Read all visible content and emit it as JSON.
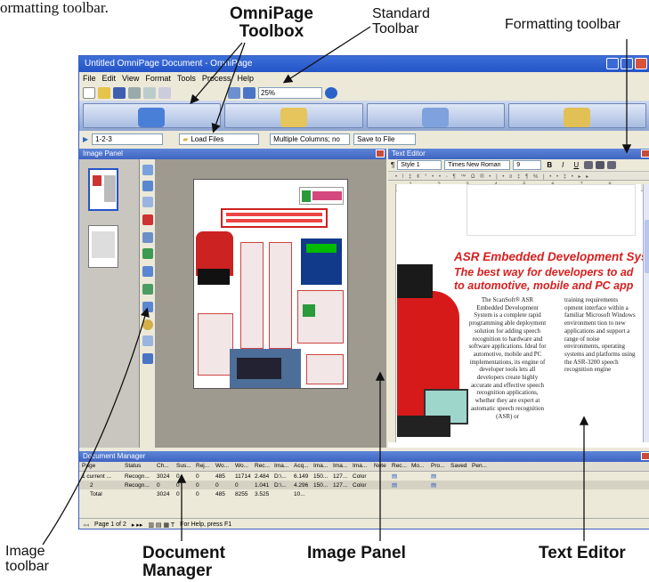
{
  "intro": {
    "text": "ormatting toolbar."
  },
  "callouts": {
    "toolbox": "OmniPage Toolbox",
    "toolbox_l1": "OmniPage",
    "toolbox_l2": "Toolbox",
    "standard_l1": "Standard",
    "standard_l2": "Toolbar",
    "formatting": "Formatting toolbar",
    "image_toolbar_l1": "Image",
    "image_toolbar_l2": "toolbar",
    "docmgr_l1": "Document",
    "docmgr_l2": "Manager",
    "image_panel": "Image Panel",
    "text_editor": "Text Editor"
  },
  "window": {
    "title": "Untitled OmniPage Document - OmniPage",
    "menu": [
      "File",
      "Edit",
      "View",
      "Format",
      "Tools",
      "Process",
      "Help"
    ],
    "zoom": "25%",
    "workflow": "1-2-3",
    "load": "Load Files",
    "layout": "Multiple Columns; no",
    "save": "Save to File"
  },
  "image_panel": {
    "title": "Image Panel"
  },
  "text_editor": {
    "title": "Text Editor",
    "style": "Style 1",
    "font": "Times New Roman",
    "size": "9",
    "bold": "B",
    "italic": "I",
    "underline": "U",
    "heading1": "ASR Embedded Development Sys",
    "heading2a": "The best way for developers to ad",
    "heading2b": "to automotive, mobile and PC app",
    "col1": "The ScanSoft® ASR Embedded Development System is a complete rapid programming able deployment solution for adding speech recognition to hardware and software applications. Ideal for automotive, mobile and PC implementations, its engine of developer tools lets all developers create highly accurate and effective speech recognition applications, whether they are expert at automatic speech recognition (ASR) or",
    "col2": "training requirements opment interface within a familiar Microsoft Windows environment tion to new applications and support a range of noise environments, operating systems and platforms using the ASR-3200 speech recognition engine"
  },
  "doc_manager": {
    "title": "Document Manager",
    "columns": [
      "Page",
      "Status",
      "Ch...",
      "Sus...",
      "Rej...",
      "Wo...",
      "Wo...",
      "Rec...",
      "Ima...",
      "Acq...",
      "Ima...",
      "Ima...",
      "Ima...",
      "Note",
      "Rec...",
      "Mo...",
      "Pro...",
      "Saved",
      "Pen..."
    ],
    "rows": [
      [
        "1 current ...",
        "Recogn...",
        "3024",
        "0",
        "0",
        "485",
        "11714",
        "2.484",
        "D:\\...",
        "6.149",
        "150...",
        "127...",
        "Color",
        "",
        "",
        "",
        "",
        "",
        ""
      ],
      [
        "2",
        "Recogn...",
        "0",
        "0",
        "0",
        "0",
        "0",
        "1.041",
        "D:\\...",
        "4.296",
        "150...",
        "127...",
        "Color",
        "",
        "",
        "",
        "",
        "",
        ""
      ],
      [
        "Total",
        "",
        "3024",
        "0",
        "0",
        "485",
        "8255",
        "3.525",
        "",
        "10...",
        "",
        "",
        "",
        "",
        "",
        "",
        "",
        "",
        ""
      ]
    ],
    "page_nav": "Page 1 of 2",
    "status": "For Help, press F1"
  },
  "colors": {
    "accent": "#2454c7",
    "heading_red": "#d81f1f",
    "panel_gray": "#a9a59c"
  }
}
